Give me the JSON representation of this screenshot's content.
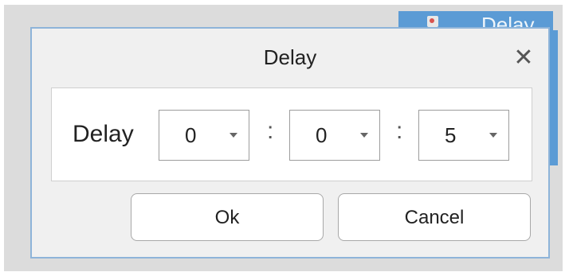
{
  "background": {
    "tab_label": "Delay"
  },
  "dialog": {
    "title": "Delay",
    "close_symbol": "✕"
  },
  "form": {
    "label": "Delay",
    "separator": ":",
    "hours": "0",
    "minutes": "0",
    "seconds": "5"
  },
  "buttons": {
    "ok_label": "Ok",
    "cancel_label": "Cancel"
  },
  "colors": {
    "accent": "#5b9bd5",
    "dialog_border": "#8eb4d9",
    "dialog_background": "#f0f0f0"
  },
  "icons": {
    "close": "close-icon",
    "dropdown": "chevron-down-icon"
  }
}
